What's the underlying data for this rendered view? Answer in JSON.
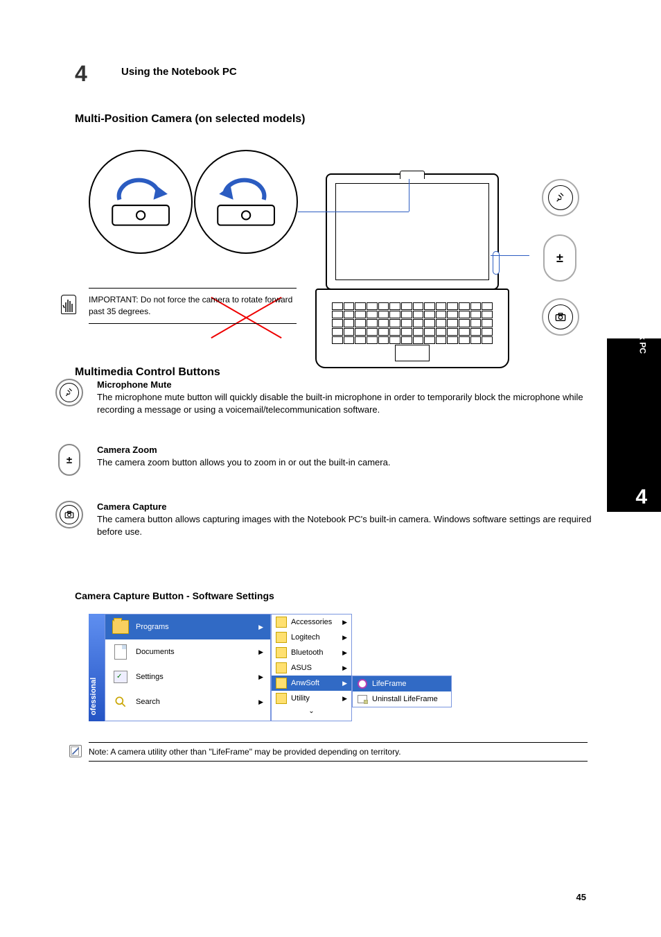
{
  "page": {
    "chapter_number": "4",
    "chapter_title": "Using the Notebook PC",
    "footer_page": "45"
  },
  "side_tab": {
    "number": "4",
    "text": "Using the Notebook PC"
  },
  "camera_section": {
    "heading": "Multi-Position Camera (on selected models)"
  },
  "caution": {
    "text": "IMPORTANT: Do not force the camera to rotate forward past 35 degrees."
  },
  "buttons_heading": "Multimedia Control Buttons",
  "button_mic": {
    "title": "Microphone Mute",
    "desc": "The microphone mute button will quickly disable the built-in microphone in order to temporarily block the microphone while recording a message or using a voicemail/telecommunication software."
  },
  "button_zoom": {
    "title": "Camera Zoom",
    "desc": "The camera zoom button allows you to zoom in or out the built-in camera."
  },
  "button_capture": {
    "title": "Camera Capture",
    "desc": "The camera button allows capturing images with the Notebook PC's built-in camera. Windows software settings are required before use."
  },
  "subsection": {
    "heading": "Camera Capture Button - Software Settings"
  },
  "start_menu": {
    "col1": [
      {
        "label": "Programs",
        "highlighted": true,
        "has_arrow": true
      },
      {
        "label": "Documents",
        "highlighted": false,
        "has_arrow": true
      },
      {
        "label": "Settings",
        "highlighted": false,
        "has_arrow": true
      },
      {
        "label": "Search",
        "highlighted": false,
        "has_arrow": true
      }
    ],
    "col2": [
      {
        "label": "Accessories",
        "highlighted": false,
        "has_arrow": true
      },
      {
        "label": "Logitech",
        "highlighted": false,
        "has_arrow": true
      },
      {
        "label": "Bluetooth",
        "highlighted": false,
        "has_arrow": true
      },
      {
        "label": "ASUS",
        "highlighted": false,
        "has_arrow": true
      },
      {
        "label": "AnwSoft",
        "highlighted": true,
        "has_arrow": true
      },
      {
        "label": "Utility",
        "highlighted": false,
        "has_arrow": true
      }
    ],
    "col3": [
      {
        "label": "LifeFrame",
        "highlighted": true
      },
      {
        "label": "Uninstall LifeFrame",
        "highlighted": false
      }
    ],
    "sidebar_text": "ofessional"
  },
  "note": {
    "text": "Note: A camera utility other than \"LifeFrame\" may be provided depending on territory."
  }
}
